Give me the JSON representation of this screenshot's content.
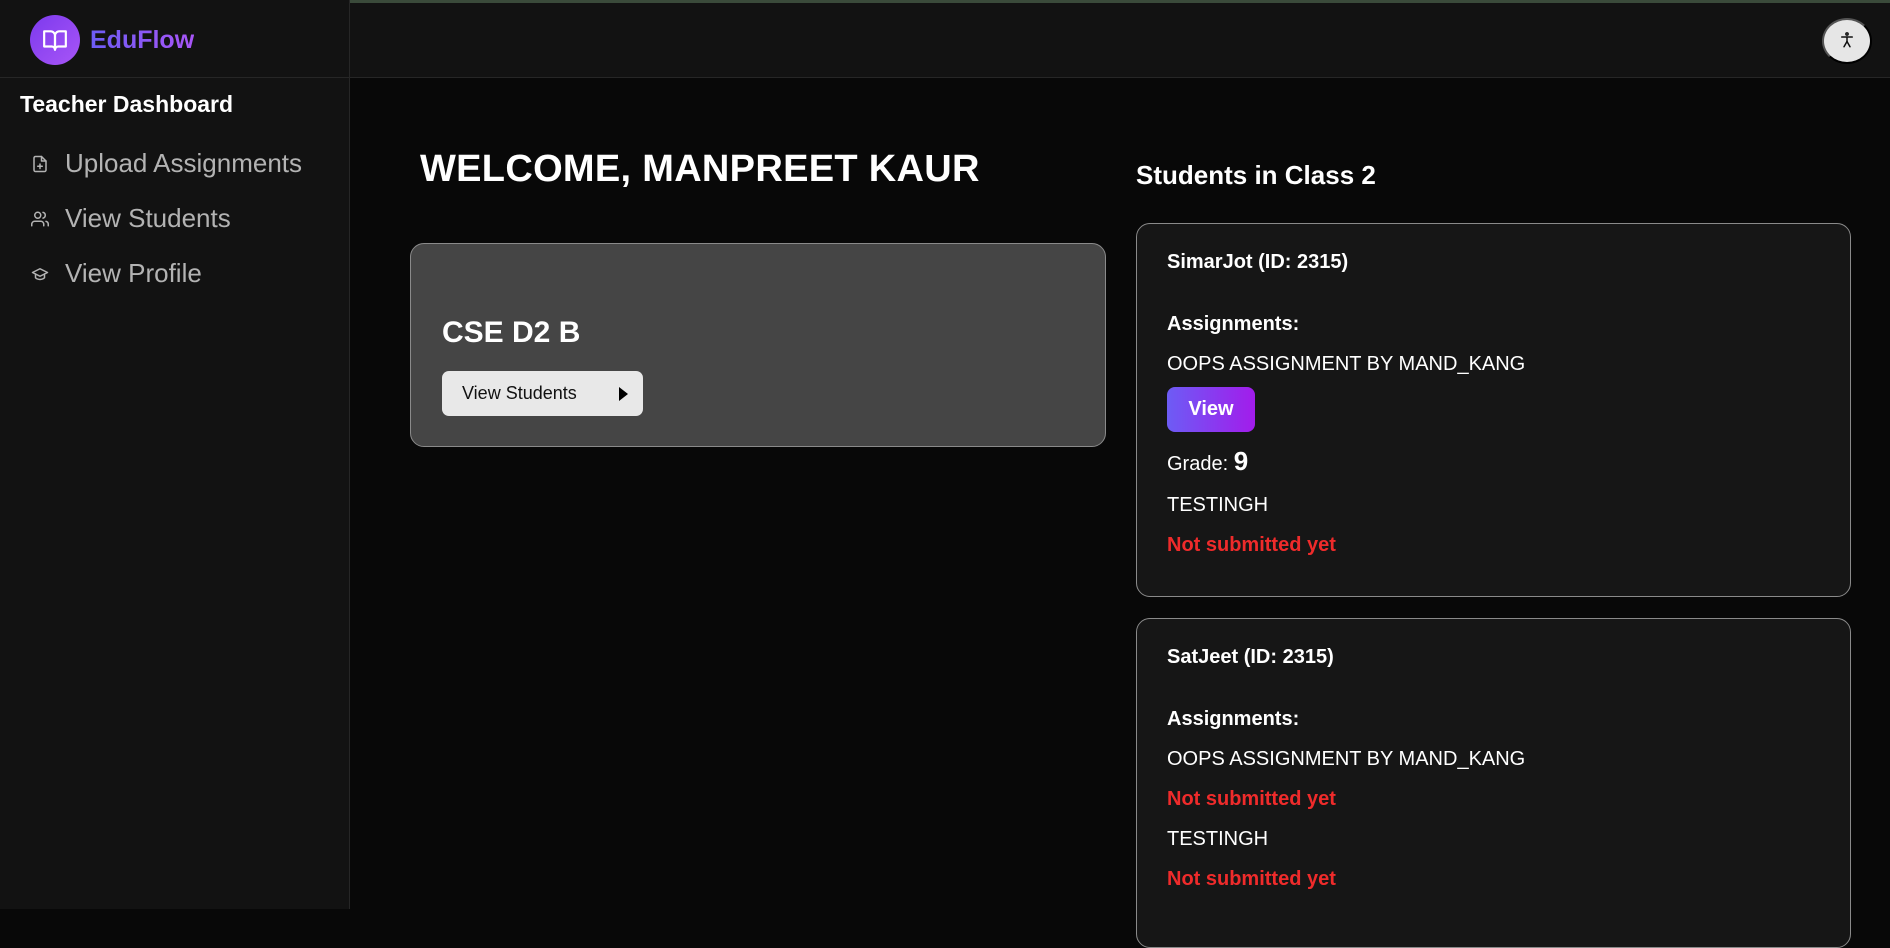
{
  "app": {
    "name": "EduFlow"
  },
  "sidebar": {
    "title": "Teacher Dashboard",
    "items": [
      {
        "label": "Upload Assignments",
        "icon": "file-plus-icon"
      },
      {
        "label": "View Students",
        "icon": "users-icon"
      },
      {
        "label": "View Profile",
        "icon": "graduation-cap-icon"
      }
    ]
  },
  "header": {
    "accessibility_icon": "accessibility-icon"
  },
  "main": {
    "welcome": "WELCOME, MANPREET KAUR",
    "class_card": {
      "name": "CSE D2 B",
      "button_label": "View Students"
    }
  },
  "students_panel": {
    "title": "Students in Class 2",
    "students": [
      {
        "name": "SimarJot (ID: 2315)",
        "assignments_label": "Assignments:",
        "assignment_1": "OOPS ASSIGNMENT BY MAND_KANG",
        "view_label": "View",
        "grade_label": "Grade:",
        "grade_value": "9",
        "assignment_2": "TESTINGH",
        "assignment_2_status": "Not submitted yet"
      },
      {
        "name": "SatJeet (ID: 2315)",
        "assignments_label": "Assignments:",
        "assignment_1": "OOPS ASSIGNMENT BY MAND_KANG",
        "assignment_1_status": "Not submitted yet",
        "assignment_2": "TESTINGH",
        "assignment_2_status": "Not submitted yet"
      }
    ]
  },
  "colors": {
    "accent": "#7c3aed",
    "danger": "#ef2b2b",
    "background": "#080808"
  }
}
